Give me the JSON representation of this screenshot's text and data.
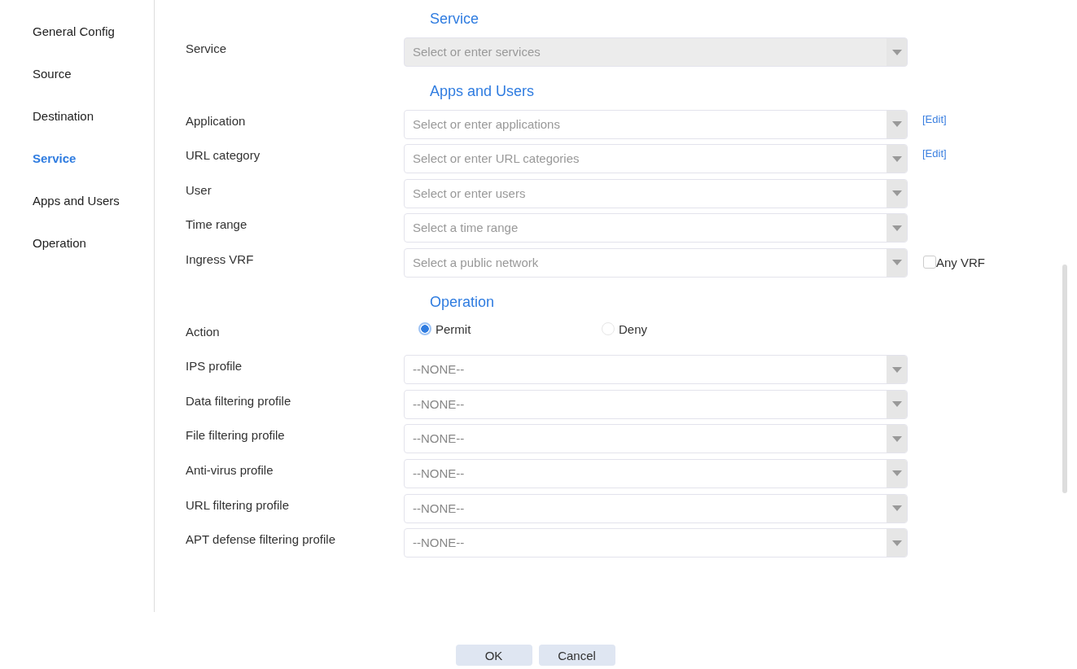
{
  "sidebar": {
    "items": [
      {
        "label": "General Config",
        "selected": false
      },
      {
        "label": "Source",
        "selected": false
      },
      {
        "label": "Destination",
        "selected": false
      },
      {
        "label": "Service",
        "selected": true
      },
      {
        "label": "Apps and Users",
        "selected": false
      },
      {
        "label": "Operation",
        "selected": false
      }
    ]
  },
  "sections": [
    {
      "title": "Service",
      "rows": [
        {
          "kind": "select",
          "label": "Service",
          "placeholder": "Select or enter services",
          "disabled": true
        }
      ]
    },
    {
      "title": "Apps and Users",
      "rows": [
        {
          "kind": "select",
          "label": "Application",
          "placeholder": "Select or enter applications",
          "disabled": false,
          "extra": {
            "kind": "link",
            "text": "[Edit]"
          }
        },
        {
          "kind": "select",
          "label": "URL category",
          "placeholder": "Select or enter URL categories",
          "disabled": false,
          "extra": {
            "kind": "link",
            "text": "[Edit]"
          }
        },
        {
          "kind": "select",
          "label": "User",
          "placeholder": "Select or enter users",
          "disabled": false
        },
        {
          "kind": "select",
          "label": "Time range",
          "placeholder": "Select a time range",
          "disabled": false
        },
        {
          "kind": "select",
          "label": "Ingress VRF",
          "placeholder": "Select a public network",
          "disabled": false,
          "extra": {
            "kind": "checkbox",
            "text": "Any VRF",
            "checked": false
          }
        }
      ]
    },
    {
      "title": "Operation",
      "rows": [
        {
          "kind": "radio",
          "label": "Action",
          "options": [
            {
              "label": "Permit",
              "selected": true
            },
            {
              "label": "Deny",
              "selected": false
            }
          ]
        },
        {
          "kind": "select",
          "label": "IPS profile",
          "value": "--NONE--",
          "disabled": false
        },
        {
          "kind": "select",
          "label": "Data filtering profile",
          "value": "--NONE--",
          "disabled": false
        },
        {
          "kind": "select",
          "label": "File filtering profile",
          "value": "--NONE--",
          "disabled": false
        },
        {
          "kind": "select",
          "label": "Anti-virus profile",
          "value": "--NONE--",
          "disabled": false
        },
        {
          "kind": "select",
          "label": "URL filtering profile",
          "value": "--NONE--",
          "disabled": false
        },
        {
          "kind": "select",
          "label": "APT defense filtering profile",
          "value": "--NONE--",
          "disabled": false
        }
      ]
    }
  ],
  "buttons": [
    "OK",
    "Cancel"
  ]
}
